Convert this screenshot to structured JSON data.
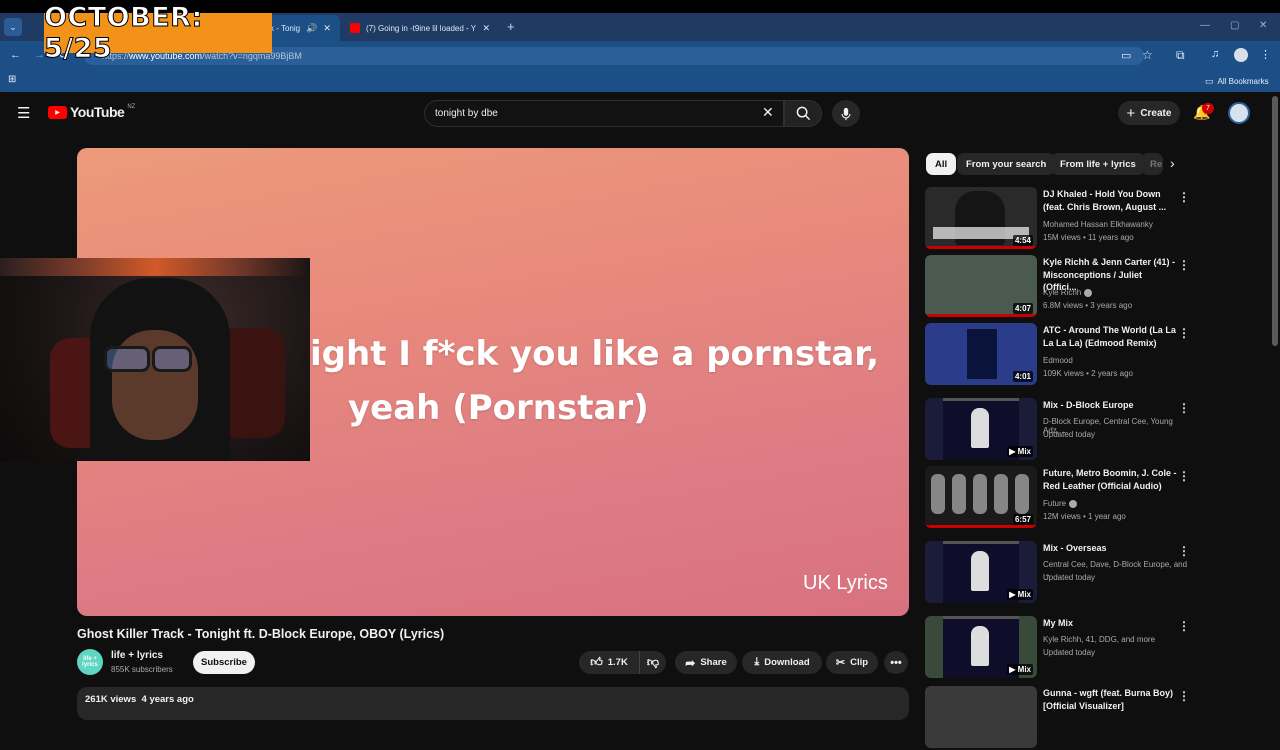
{
  "overlay": {
    "timer_text": "OCTOBER: 5/25"
  },
  "browser": {
    "tabs": [
      {
        "title": "ck - Tonig",
        "active": true
      },
      {
        "title": "(7) Going in -t9ine lil loaded - Y",
        "active": false
      }
    ],
    "url_prefix": "https://",
    "url_domain": "www.youtube.com",
    "url_path": "/watch?v=ngqma99BjBM",
    "bookmarks_label": "All Bookmarks"
  },
  "youtube": {
    "logo_text": "YouTube",
    "country": "NZ",
    "search_value": "tonight by dbe",
    "create_label": "Create",
    "notification_count": "7"
  },
  "video": {
    "lyric_line1": "ight I f*ck you like a pornstar,",
    "lyric_line2": "yeah (Pornstar)",
    "watermark": "UK Lyrics",
    "title": "Ghost Killer Track - Tonight ft. D-Block Europe, OBOY (Lyrics)",
    "channel": "life + lyrics",
    "channel_avatar_text": "life + lyrics",
    "subscribers": "855K subscribers",
    "subscribe_label": "Subscribe",
    "likes": "1.7K",
    "share_label": "Share",
    "download_label": "Download",
    "clip_label": "Clip",
    "views": "261K views",
    "age": "4 years ago"
  },
  "chips": [
    "All",
    "From your search",
    "From life + lyrics",
    "Re"
  ],
  "recommendations": [
    {
      "title": "DJ Khaled - Hold You Down (feat. Chris Brown, August ...",
      "channel": "Mohamed Hassan Elkhawanky",
      "meta": "15M views • 11 years ago",
      "duration": "4:54",
      "thumb": "#2a2a2a"
    },
    {
      "title": "Kyle Richh & Jenn Carter (41) - Misconceptions / Juliet (Offici...",
      "channel": "Kyle Richh",
      "meta": "6.8M views • 3 years ago",
      "duration": "4:07",
      "thumb": "#4a5a4e"
    },
    {
      "title": "ATC - Around The World (La La La La La) (Edmood Remix)",
      "channel": "Edmood",
      "meta": "109K views • 2 years ago",
      "duration": "4:01",
      "thumb": "#2b3d8a"
    },
    {
      "title": "Mix - D-Block Europe",
      "channel": "D-Block Europe, Central Cee, Young Adz, ...",
      "meta": "Updated today",
      "duration": "Mix",
      "thumb": "#1b1b3a"
    },
    {
      "title": "Future, Metro Boomin, J. Cole - Red Leather (Official Audio)",
      "channel": "Future",
      "meta": "12M views • 1 year ago",
      "duration": "6:57",
      "thumb": "#1a1a1a"
    },
    {
      "title": "Mix - Overseas",
      "channel": "Central Cee, Dave, D-Block Europe, and ...",
      "meta": "Updated today",
      "duration": "Mix",
      "thumb": "#1b1b3a"
    },
    {
      "title": "My Mix",
      "channel": "Kyle Richh, 41, DDG, and more",
      "meta": "Updated today",
      "duration": "Mix",
      "thumb": "#3a4a3a"
    },
    {
      "title": "Gunna - wgft (feat. Burna Boy) [Official Visualizer]",
      "channel": "",
      "meta": "",
      "duration": "",
      "thumb": "#3a3a3a"
    }
  ]
}
